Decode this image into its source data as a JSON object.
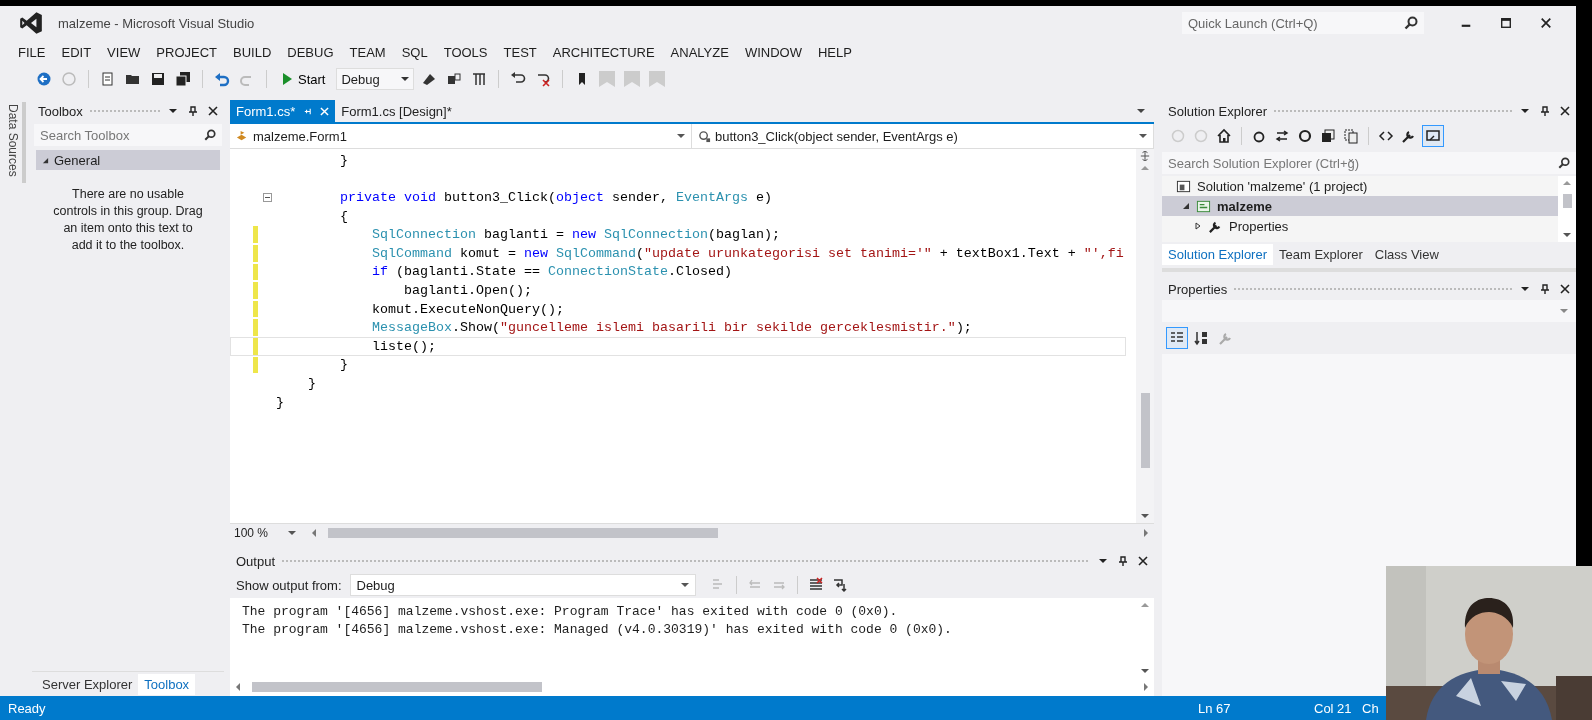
{
  "window": {
    "title": "malzeme - Microsoft Visual Studio"
  },
  "quick_launch": {
    "placeholder": "Quick Launch (Ctrl+Q)"
  },
  "menu": [
    "FILE",
    "EDIT",
    "VIEW",
    "PROJECT",
    "BUILD",
    "DEBUG",
    "TEAM",
    "SQL",
    "TOOLS",
    "TEST",
    "ARCHITECTURE",
    "ANALYZE",
    "WINDOW",
    "HELP"
  ],
  "toolbar": {
    "start": "Start",
    "configuration": "Debug"
  },
  "side_tab": "Data Sources",
  "toolbox": {
    "title": "Toolbox",
    "search": {
      "placeholder": "Search Toolbox"
    },
    "group": {
      "label": "General",
      "expanded": true
    },
    "message": "There are no usable controls in this group. Drag an item onto this text to add it to the toolbox."
  },
  "left_tabs": [
    {
      "label": "Server Explorer",
      "selected": false
    },
    {
      "label": "Toolbox",
      "selected": true
    }
  ],
  "editor": {
    "tabs": [
      {
        "label": "Form1.cs*",
        "selected": true
      },
      {
        "label": "Form1.cs [Design]*",
        "selected": false
      }
    ],
    "class_dropdown": "malzeme.Form1",
    "member_dropdown": "button3_Click(object sender, EventArgs e)",
    "zoom": "100 %",
    "lines": [
      {
        "kind": "code",
        "modified": false,
        "current": false,
        "collapsible": false,
        "tokens": [
          {
            "kind": "plain",
            "text": "        }"
          }
        ]
      },
      {
        "kind": "blank"
      },
      {
        "kind": "code",
        "modified": false,
        "current": false,
        "collapsible": true,
        "tokens": [
          {
            "kind": "keyword",
            "text": "        private void"
          },
          {
            "kind": "plain",
            "text": " button3_Click("
          },
          {
            "kind": "keyword",
            "text": "object"
          },
          {
            "kind": "plain",
            "text": " sender, "
          },
          {
            "kind": "type",
            "text": "EventArgs"
          },
          {
            "kind": "plain",
            "text": " e)"
          }
        ]
      },
      {
        "kind": "code",
        "modified": false,
        "current": false,
        "collapsible": false,
        "tokens": [
          {
            "kind": "plain",
            "text": "        {"
          }
        ]
      },
      {
        "kind": "code",
        "modified": true,
        "current": false,
        "collapsible": false,
        "tokens": [
          {
            "kind": "type",
            "text": "            SqlConnection"
          },
          {
            "kind": "plain",
            "text": " baglanti = "
          },
          {
            "kind": "keyword",
            "text": "new"
          },
          {
            "kind": "type",
            "text": " SqlConnection"
          },
          {
            "kind": "plain",
            "text": "(baglan);"
          }
        ]
      },
      {
        "kind": "code",
        "modified": true,
        "current": false,
        "collapsible": false,
        "tokens": [
          {
            "kind": "type",
            "text": "            SqlCommand"
          },
          {
            "kind": "plain",
            "text": " komut = "
          },
          {
            "kind": "keyword",
            "text": "new"
          },
          {
            "kind": "type",
            "text": " SqlCommand"
          },
          {
            "kind": "plain",
            "text": "("
          },
          {
            "kind": "string",
            "text": "\"update urunkategorisi set tanimi='\""
          },
          {
            "kind": "plain",
            "text": " + textBox1.Text + "
          },
          {
            "kind": "string",
            "text": "\"',fi"
          }
        ]
      },
      {
        "kind": "code",
        "modified": true,
        "current": false,
        "collapsible": false,
        "tokens": [
          {
            "kind": "keyword",
            "text": "            if"
          },
          {
            "kind": "plain",
            "text": " (baglanti.State == "
          },
          {
            "kind": "type",
            "text": "ConnectionState"
          },
          {
            "kind": "plain",
            "text": ".Closed)"
          }
        ]
      },
      {
        "kind": "code",
        "modified": true,
        "current": false,
        "collapsible": false,
        "tokens": [
          {
            "kind": "plain",
            "text": "                baglanti.Open();"
          }
        ]
      },
      {
        "kind": "code",
        "modified": true,
        "current": false,
        "collapsible": false,
        "tokens": [
          {
            "kind": "plain",
            "text": "            komut.ExecuteNonQuery();"
          }
        ]
      },
      {
        "kind": "code",
        "modified": true,
        "current": false,
        "collapsible": false,
        "tokens": [
          {
            "kind": "type",
            "text": "            MessageBox"
          },
          {
            "kind": "plain",
            "text": ".Show("
          },
          {
            "kind": "string",
            "text": "\"guncelleme islemi basarili bir sekilde gerceklesmistir.\""
          },
          {
            "kind": "plain",
            "text": ");"
          }
        ]
      },
      {
        "kind": "code",
        "modified": true,
        "current": true,
        "collapsible": false,
        "tokens": [
          {
            "kind": "plain",
            "text": "            liste();"
          }
        ]
      },
      {
        "kind": "code",
        "modified": true,
        "current": false,
        "collapsible": false,
        "tokens": [
          {
            "kind": "plain",
            "text": "        }"
          }
        ]
      },
      {
        "kind": "code",
        "modified": false,
        "current": false,
        "collapsible": false,
        "tokens": [
          {
            "kind": "plain",
            "text": "    }"
          }
        ]
      },
      {
        "kind": "code",
        "modified": false,
        "current": false,
        "collapsible": false,
        "tokens": [
          {
            "kind": "plain",
            "text": "}"
          }
        ]
      }
    ]
  },
  "output": {
    "title": "Output",
    "source_label": "Show output from:",
    "source": "Debug",
    "lines": [
      "The program '[4656] malzeme.vshost.exe: Program Trace' has exited with code 0 (0x0).",
      "The program '[4656] malzeme.vshost.exe: Managed (v4.0.30319)' has exited with code 0 (0x0)."
    ]
  },
  "solution_explorer": {
    "title": "Solution Explorer",
    "search": {
      "placeholder": "Search Solution Explorer (Ctrl+ğ)"
    },
    "tree": [
      {
        "label": "Solution 'malzeme' (1 project)",
        "kind": "solution",
        "selected": false,
        "children": [
          {
            "label": "malzeme",
            "kind": "project",
            "selected": true,
            "expanded": true,
            "children": [
              {
                "label": "Properties",
                "kind": "properties",
                "selected": false,
                "expanded": false
              }
            ]
          }
        ]
      }
    ],
    "tabs": [
      {
        "label": "Solution Explorer",
        "selected": true
      },
      {
        "label": "Team Explorer",
        "selected": false
      },
      {
        "label": "Class View",
        "selected": false
      }
    ]
  },
  "properties": {
    "title": "Properties"
  },
  "status_bar": {
    "text": "Ready",
    "line": "Ln 67",
    "column": "Col 21",
    "character": "Ch"
  }
}
